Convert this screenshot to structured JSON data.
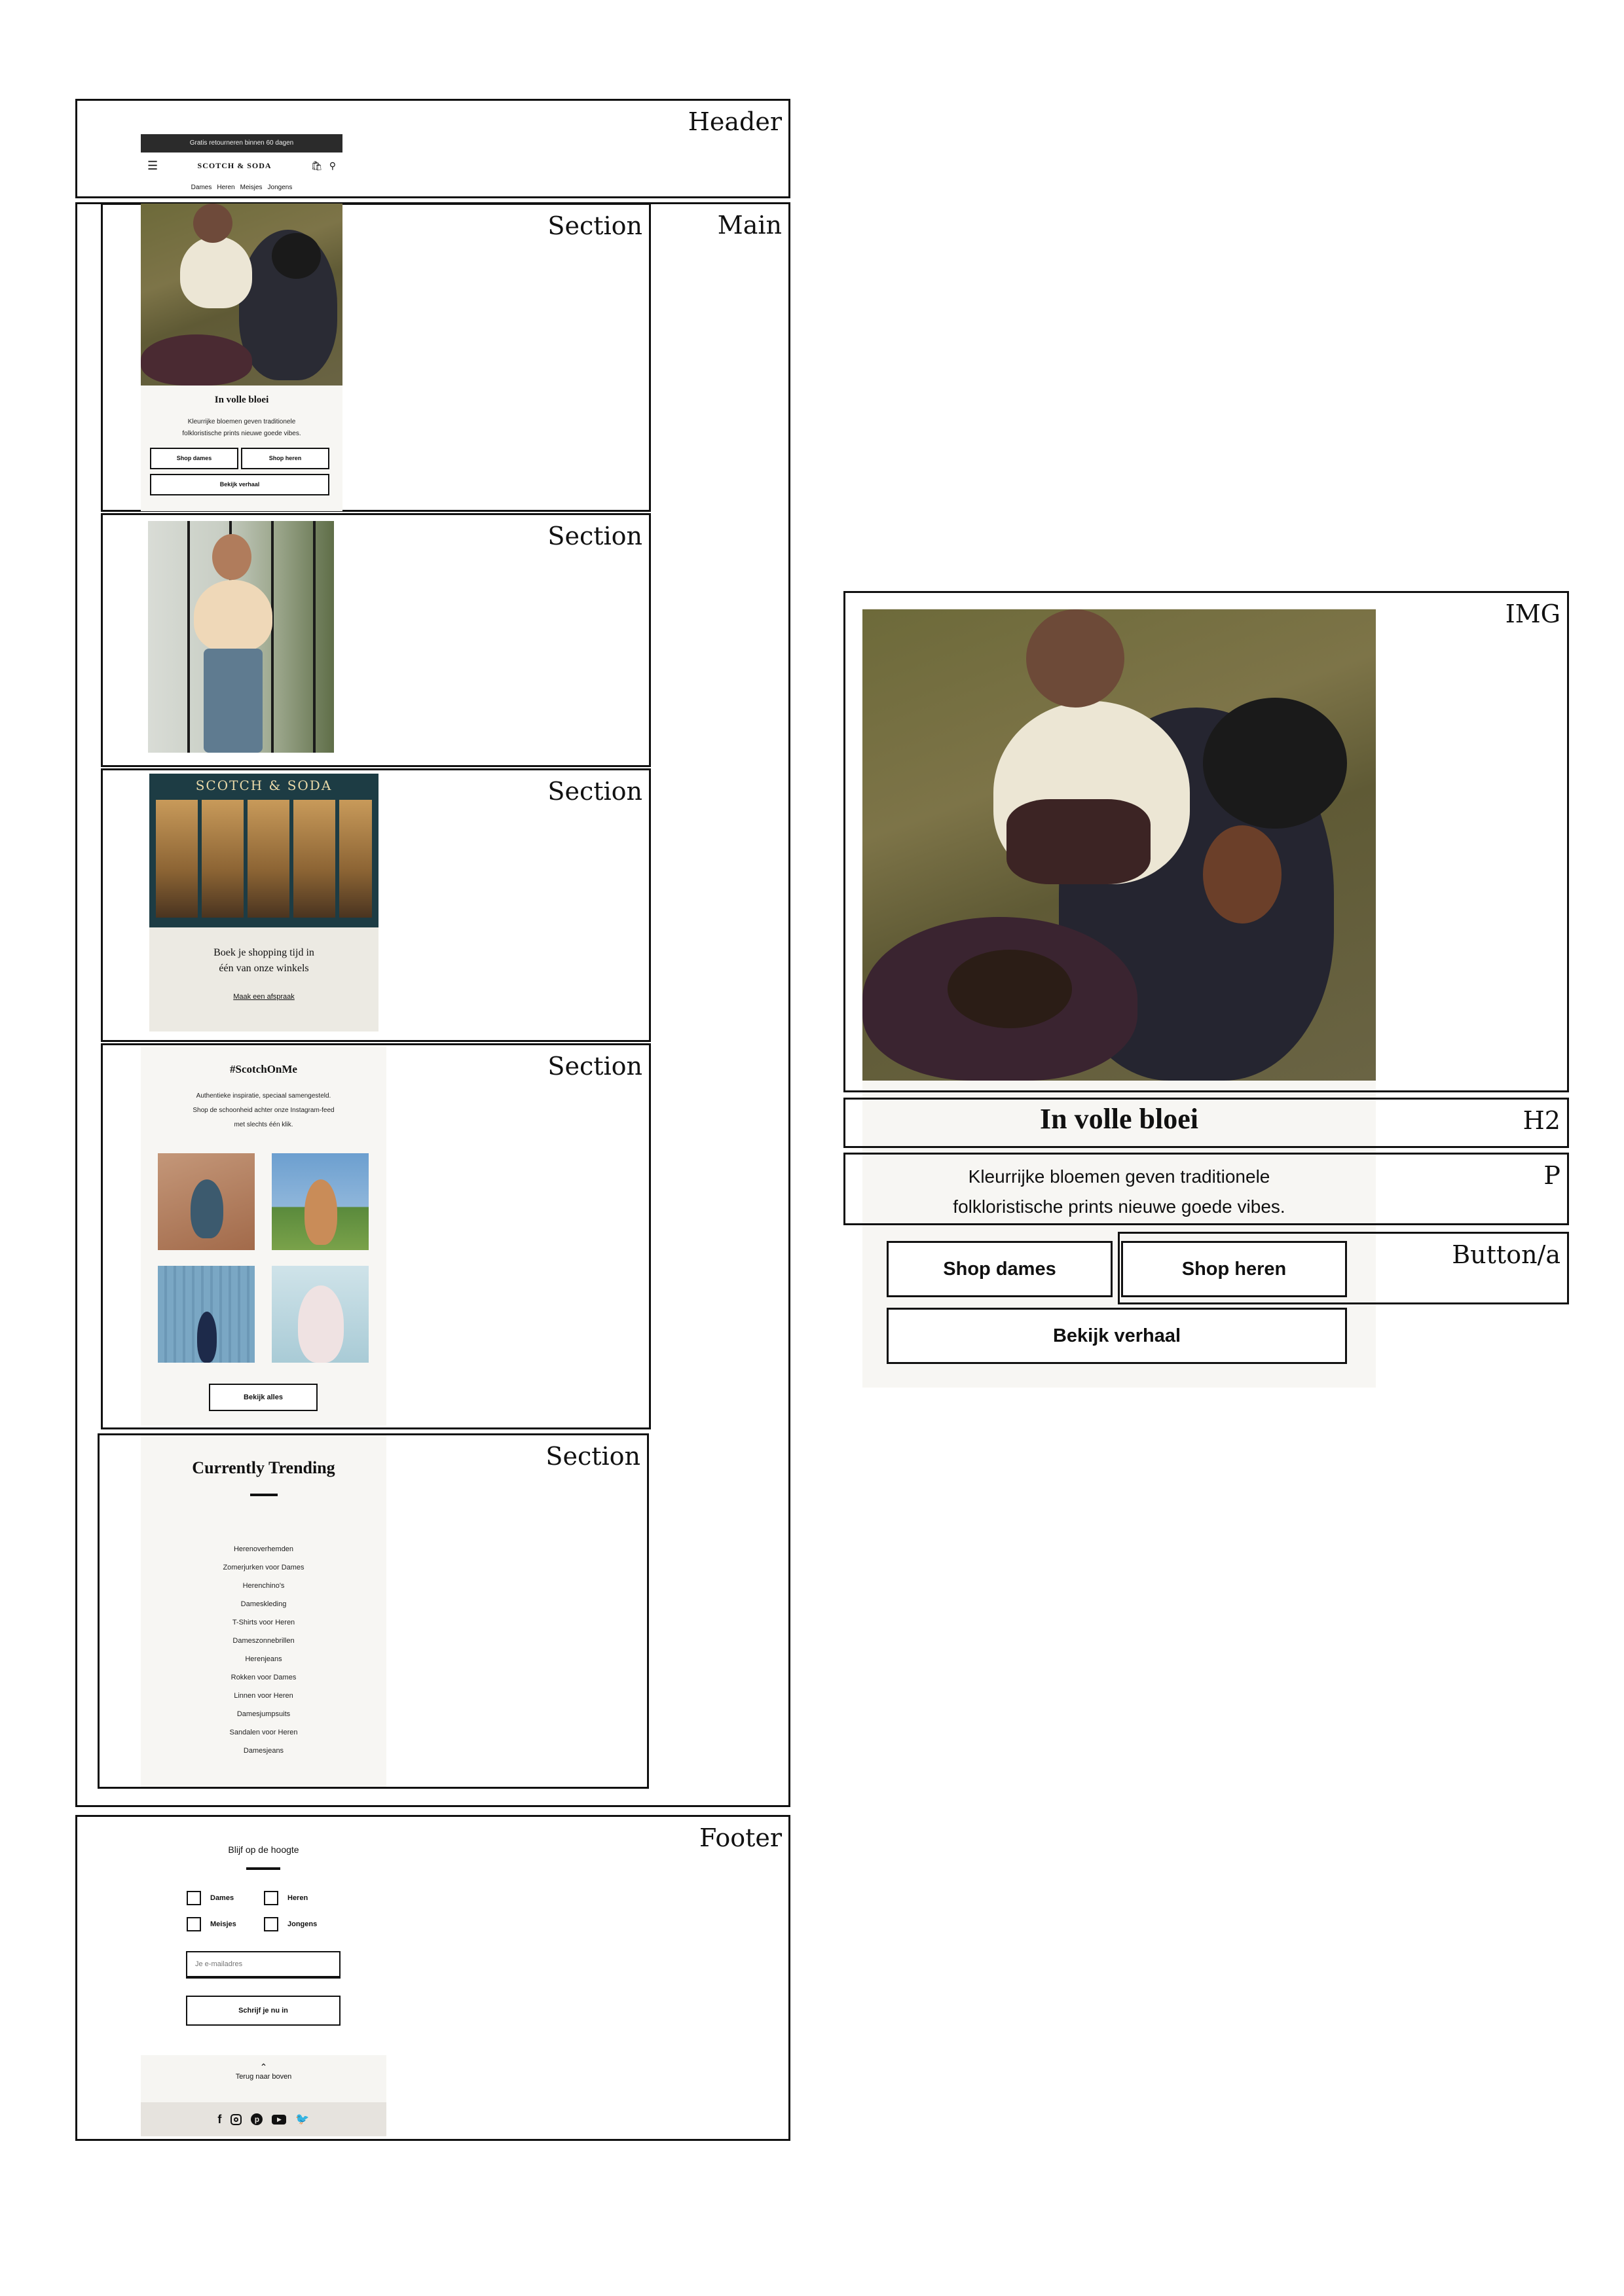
{
  "labels": {
    "header": "Header",
    "main": "Main",
    "section": "Section",
    "footer": "Footer",
    "img": "IMG",
    "h2": "H2",
    "p": "P",
    "button": "Button/a"
  },
  "header": {
    "announcement": "Gratis retourneren binnen 60 dagen",
    "logo": "SCOTCH & SODA",
    "nav": [
      "Dames",
      "Heren",
      "Meisjes",
      "Jongens"
    ]
  },
  "hero": {
    "title": "In volle bloei",
    "text_line1": "Kleurrijke bloemen geven traditionele",
    "text_line2": "folkloristische prints nieuwe goede vibes.",
    "btn_dames": "Shop dames",
    "btn_heren": "Shop heren",
    "btn_story": "Bekijk verhaal"
  },
  "store": {
    "sign": "SCOTCH & SODA",
    "text_line1": "Boek je shopping tijd in",
    "text_line2": "één van onze winkels",
    "link": "Maak een afspraak"
  },
  "instagram": {
    "title": "#ScotchOnMe",
    "text_line1": "Authentieke inspiratie, speciaal samengesteld.",
    "text_line2": "Shop de schoonheid achter onze Instagram-feed",
    "text_line3": "met slechts één klik.",
    "button": "Bekijk alles"
  },
  "trending": {
    "title": "Currently Trending",
    "items": [
      "Herenoverhemden",
      "Zomerjurken voor Dames",
      "Herenchino's",
      "Dameskleding",
      "T-Shirts voor Heren",
      "Dameszonnebrillen",
      "Herenjeans",
      "Rokken voor Dames",
      "Linnen voor Heren",
      "Damesjumpsuits",
      "Sandalen voor Heren",
      "Damesjeans"
    ]
  },
  "footer": {
    "title": "Blijf op de hoogte",
    "options": [
      "Dames",
      "Heren",
      "Meisjes",
      "Jongens"
    ],
    "email_placeholder": "Je e-mailadres",
    "subscribe": "Schrijf je nu in",
    "back_to_top": "Terug naar boven",
    "social_icons": [
      "facebook-icon",
      "instagram-icon",
      "pinterest-icon",
      "youtube-icon",
      "twitter-icon"
    ]
  }
}
